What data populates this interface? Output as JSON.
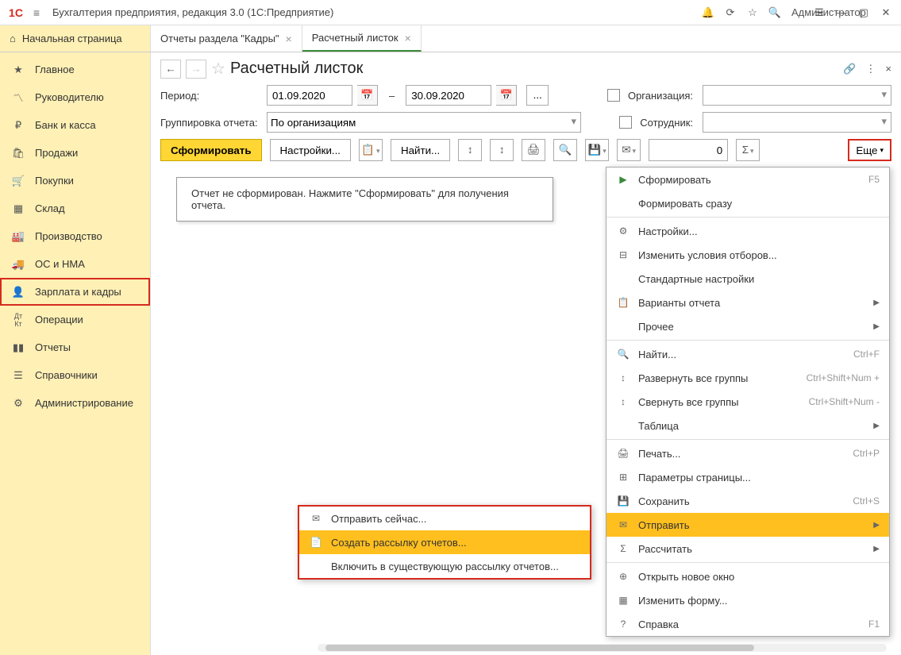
{
  "window": {
    "title": "Бухгалтерия предприятия, редакция 3.0  (1С:Предприятие)",
    "user": "Администратор"
  },
  "tabs": {
    "home": "Начальная страница",
    "tab1": "Отчеты раздела \"Кадры\"",
    "tab2": "Расчетный листок"
  },
  "sidebar": {
    "items": [
      {
        "label": "Главное",
        "icon": "★"
      },
      {
        "label": "Руководителю",
        "icon": "📈"
      },
      {
        "label": "Банк и касса",
        "icon": "₽"
      },
      {
        "label": "Продажи",
        "icon": "🛍"
      },
      {
        "label": "Покупки",
        "icon": "🛒"
      },
      {
        "label": "Склад",
        "icon": "📦"
      },
      {
        "label": "Производство",
        "icon": "🏭"
      },
      {
        "label": "ОС и НМА",
        "icon": "🚚"
      },
      {
        "label": "Зарплата и кадры",
        "icon": "👤"
      },
      {
        "label": "Операции",
        "icon": "Дт/Кт"
      },
      {
        "label": "Отчеты",
        "icon": "📊"
      },
      {
        "label": "Справочники",
        "icon": "📚"
      },
      {
        "label": "Администрирование",
        "icon": "⚙"
      }
    ]
  },
  "page": {
    "title": "Расчетный листок",
    "period_label": "Период:",
    "date_from": "01.09.2020",
    "date_to": "30.09.2020",
    "grouping_label": "Группировка отчета:",
    "grouping_value": "По организациям",
    "org_label": "Организация:",
    "emp_label": "Сотрудник:",
    "form_btn": "Сформировать",
    "settings_btn": "Настройки...",
    "find_btn": "Найти...",
    "num_value": "0",
    "more_btn": "Еще",
    "report_placeholder": "Отчет не сформирован. Нажмите \"Сформировать\" для получения отчета."
  },
  "more_menu": {
    "form": "Сформировать",
    "form_sc": "F5",
    "form_now": "Формировать сразу",
    "settings": "Настройки...",
    "filters": "Изменить условия отборов...",
    "std": "Стандартные настройки",
    "variants": "Варианты отчета",
    "other": "Прочее",
    "find": "Найти...",
    "find_sc": "Ctrl+F",
    "expand": "Развернуть все группы",
    "expand_sc": "Ctrl+Shift+Num +",
    "collapse": "Свернуть все группы",
    "collapse_sc": "Ctrl+Shift+Num -",
    "table": "Таблица",
    "print": "Печать...",
    "print_sc": "Ctrl+P",
    "page_params": "Параметры страницы...",
    "save": "Сохранить",
    "save_sc": "Ctrl+S",
    "send": "Отправить",
    "calc": "Рассчитать",
    "new_wnd": "Открыть новое окно",
    "edit_form": "Изменить форму...",
    "help": "Справка",
    "help_sc": "F1"
  },
  "send_menu": {
    "now": "Отправить сейчас...",
    "create": "Создать рассылку отчетов...",
    "include": "Включить в существующую рассылку отчетов..."
  }
}
